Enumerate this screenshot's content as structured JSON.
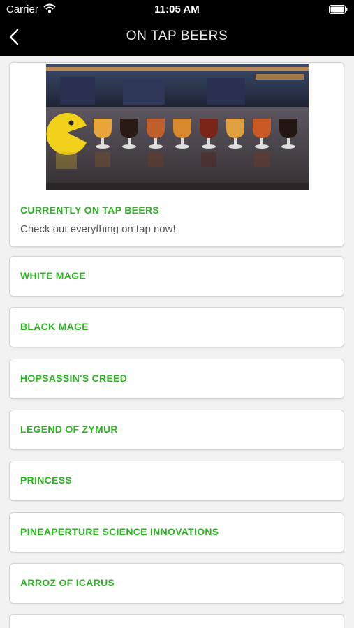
{
  "status": {
    "carrier": "Carrier",
    "time": "11:05 AM"
  },
  "nav": {
    "title": "ON TAP BEERS"
  },
  "hero": {
    "title": "CURRENTLY ON TAP BEERS",
    "subtitle": "Check out everything on tap now!"
  },
  "beers": [
    {
      "name": "WHITE MAGE"
    },
    {
      "name": "BLACK MAGE"
    },
    {
      "name": "HOPSASSIN'S CREED"
    },
    {
      "name": "LEGEND OF ZYMUR"
    },
    {
      "name": "PRINCESS"
    },
    {
      "name": "PINEAPERTURE SCIENCE INNOVATIONS"
    },
    {
      "name": "ARROZ OF ICARUS"
    },
    {
      "name": ""
    }
  ],
  "colors": {
    "accent": "#2ab521",
    "navbar": "#000000",
    "background": "#f2f2f2"
  }
}
